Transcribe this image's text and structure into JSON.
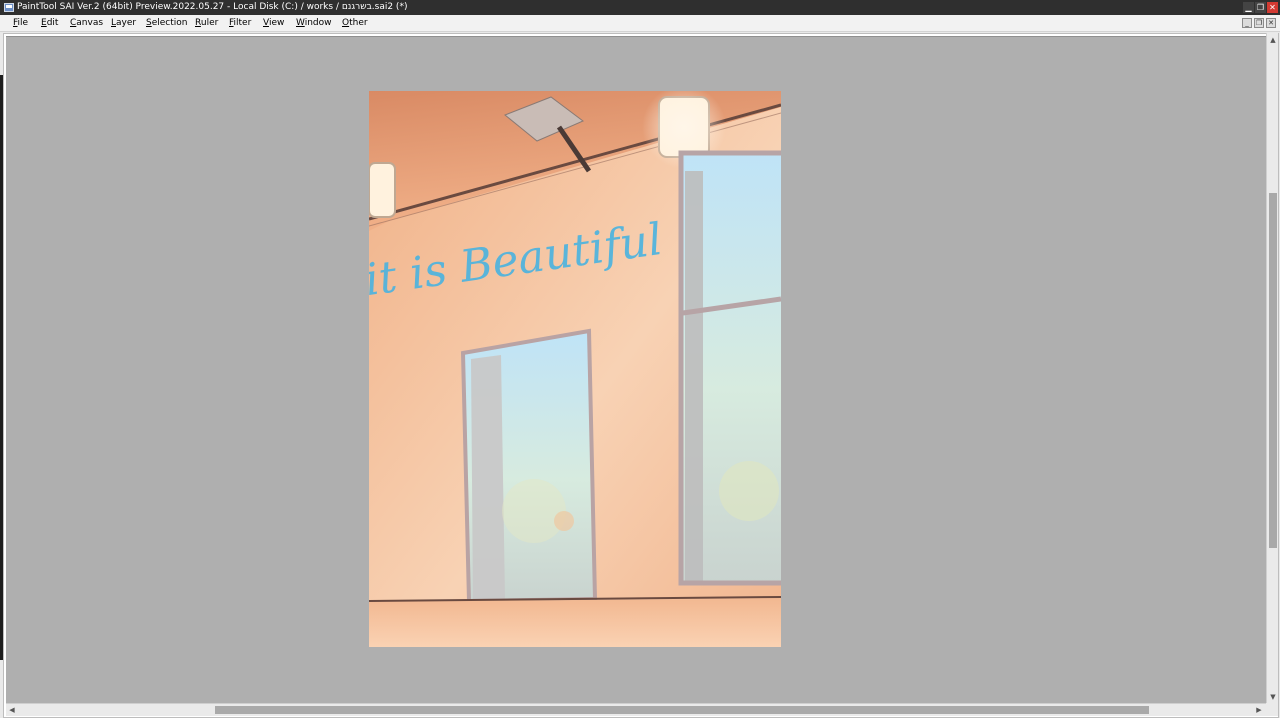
{
  "window": {
    "title": "PaintTool SAI Ver.2 (64bit) Preview.2022.05.27 - Local Disk (C:) / works / בשרגנם.sai2 (*)"
  },
  "title_buttons": {
    "minimize": "▁",
    "maximize": "❐",
    "close": "✕"
  },
  "menu": [
    {
      "label": "File",
      "key": "F",
      "rest": "ile"
    },
    {
      "label": "Edit",
      "key": "E",
      "rest": "dit"
    },
    {
      "label": "Canvas",
      "key": "C",
      "rest": "anvas"
    },
    {
      "label": "Layer",
      "key": "L",
      "rest": "ayer"
    },
    {
      "label": "Selection",
      "key": "S",
      "rest": "election"
    },
    {
      "label": "Ruler",
      "key": "R",
      "rest": "uler"
    },
    {
      "label": "Filter",
      "key": "F",
      "rest": "ilter"
    },
    {
      "label": "View",
      "key": "V",
      "rest": "iew"
    },
    {
      "label": "Window",
      "key": "W",
      "rest": "indow"
    },
    {
      "label": "Other",
      "key": "O",
      "rest": "ther"
    }
  ],
  "canvas": {
    "artwork_text": "it is Beautiful"
  },
  "colors": {
    "titlebar": "#2f2f2f",
    "viewport": "#afafaf",
    "close_button": "#d23a32",
    "wall": "#f1ba93",
    "lettering": "#4ab3e0"
  },
  "icons": {
    "app": "painttool-sai-icon",
    "scroll_up": "▲",
    "scroll_down": "▼",
    "scroll_left": "◀",
    "scroll_right": "▶"
  }
}
